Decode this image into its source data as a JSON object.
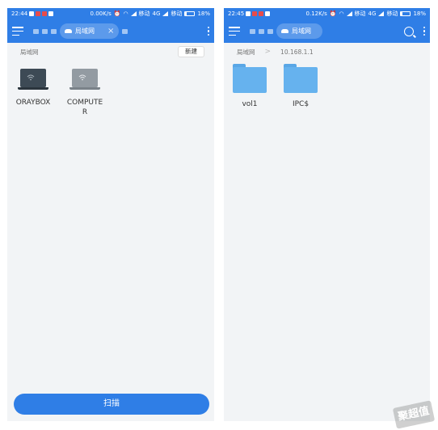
{
  "left": {
    "status": {
      "time": "22:44",
      "speed": "0.00K/s",
      "carrier1": "移动",
      "net": "4G",
      "carrier2": "移动",
      "battery": "18%"
    },
    "appbar": {
      "tab_label": "局域网",
      "tab_close": "×"
    },
    "path": {
      "crumb": "局域网",
      "new_button": "新建"
    },
    "items": [
      {
        "label": "ORAYBOX",
        "icon": "laptop-dark-icon"
      },
      {
        "label": "COMPUTER",
        "icon": "laptop-grey-icon"
      }
    ],
    "scan_button": "扫描"
  },
  "right": {
    "status": {
      "time": "22:45",
      "speed": "0.12K/s",
      "carrier1": "移动",
      "net": "4G",
      "carrier2": "移动",
      "battery": "18%"
    },
    "appbar": {
      "tab_label": "局域网"
    },
    "path": {
      "crumb": "局域网",
      "sep": ">",
      "address": "10.168.1.1"
    },
    "items": [
      {
        "label": "vol1",
        "icon": "folder-icon"
      },
      {
        "label": "IPC$",
        "icon": "folder-icon"
      }
    ]
  },
  "watermark": "聚超值",
  "colors": {
    "accent": "#2f7ee6",
    "folder": "#66b2ee",
    "background": "#f2f4f6"
  }
}
